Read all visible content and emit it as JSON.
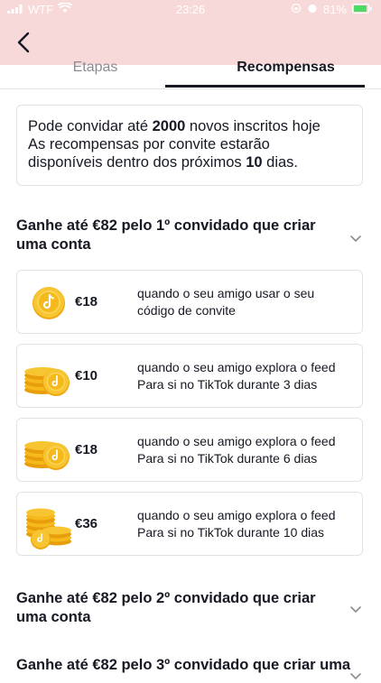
{
  "status_bar": {
    "carrier": "WTF",
    "time": "23:26",
    "battery": "81%"
  },
  "navigation": {
    "back_icon": "chevron-left-icon"
  },
  "tabs": [
    {
      "label": "Etapas"
    },
    {
      "label": "Recompensas",
      "active": true
    }
  ],
  "info": {
    "line1_prefix": "Pode convidar até ",
    "line1_number": "2000",
    "line1_suffix": " novos inscritos hoje",
    "line2": "As recompensas por convite estarão",
    "line3_prefix": "disponíveis dentro dos próximos ",
    "line3_number": "10",
    "line3_suffix": " dias."
  },
  "sections": [
    {
      "title": "Ganhe até €82 pelo 1º convidado que criar uma conta",
      "expanded": true,
      "rewards": [
        {
          "amount": "€18",
          "line1": "quando o seu amigo usar o seu",
          "line2": "código de convite",
          "icon": "single-coin-icon"
        },
        {
          "amount": "€10",
          "line1": "quando o seu amigo explora o feed",
          "line2": "Para si no TikTok durante 3 dias",
          "icon": "coin-stack-icon"
        },
        {
          "amount": "€18",
          "line1": "quando o seu amigo explora o feed",
          "line2": "Para si no TikTok durante 6 dias",
          "icon": "coin-stack-icon"
        },
        {
          "amount": "€36",
          "line1": "quando o seu amigo explora o feed",
          "line2": "Para si no TikTok durante 10 dias",
          "icon": "coin-pile-icon"
        }
      ]
    },
    {
      "title": "Ganhe até €82 pelo 2º convidado que criar uma conta",
      "expanded": false
    },
    {
      "title": "Ganhe até €82 pelo 3º convidado que criar uma",
      "expanded": false
    }
  ],
  "colors": {
    "header_bg": "#f8d9d9",
    "coin_gold": "#f5b91c",
    "text": "#161823"
  }
}
